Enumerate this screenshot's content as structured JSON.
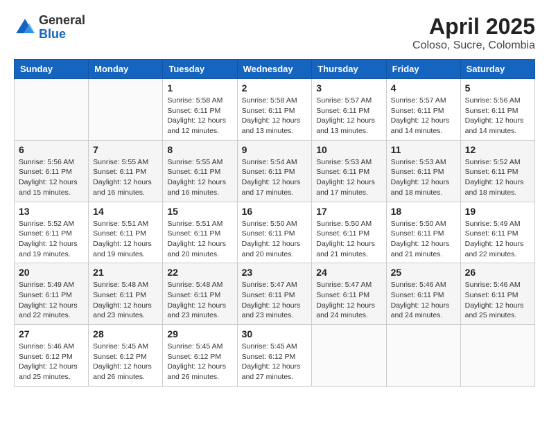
{
  "header": {
    "logo_general": "General",
    "logo_blue": "Blue",
    "title": "April 2025",
    "subtitle": "Coloso, Sucre, Colombia"
  },
  "weekdays": [
    "Sunday",
    "Monday",
    "Tuesday",
    "Wednesday",
    "Thursday",
    "Friday",
    "Saturday"
  ],
  "weeks": [
    [
      {
        "day": "",
        "sunrise": "",
        "sunset": "",
        "daylight": ""
      },
      {
        "day": "",
        "sunrise": "",
        "sunset": "",
        "daylight": ""
      },
      {
        "day": "1",
        "sunrise": "Sunrise: 5:58 AM",
        "sunset": "Sunset: 6:11 PM",
        "daylight": "Daylight: 12 hours and 12 minutes."
      },
      {
        "day": "2",
        "sunrise": "Sunrise: 5:58 AM",
        "sunset": "Sunset: 6:11 PM",
        "daylight": "Daylight: 12 hours and 13 minutes."
      },
      {
        "day": "3",
        "sunrise": "Sunrise: 5:57 AM",
        "sunset": "Sunset: 6:11 PM",
        "daylight": "Daylight: 12 hours and 13 minutes."
      },
      {
        "day": "4",
        "sunrise": "Sunrise: 5:57 AM",
        "sunset": "Sunset: 6:11 PM",
        "daylight": "Daylight: 12 hours and 14 minutes."
      },
      {
        "day": "5",
        "sunrise": "Sunrise: 5:56 AM",
        "sunset": "Sunset: 6:11 PM",
        "daylight": "Daylight: 12 hours and 14 minutes."
      }
    ],
    [
      {
        "day": "6",
        "sunrise": "Sunrise: 5:56 AM",
        "sunset": "Sunset: 6:11 PM",
        "daylight": "Daylight: 12 hours and 15 minutes."
      },
      {
        "day": "7",
        "sunrise": "Sunrise: 5:55 AM",
        "sunset": "Sunset: 6:11 PM",
        "daylight": "Daylight: 12 hours and 16 minutes."
      },
      {
        "day": "8",
        "sunrise": "Sunrise: 5:55 AM",
        "sunset": "Sunset: 6:11 PM",
        "daylight": "Daylight: 12 hours and 16 minutes."
      },
      {
        "day": "9",
        "sunrise": "Sunrise: 5:54 AM",
        "sunset": "Sunset: 6:11 PM",
        "daylight": "Daylight: 12 hours and 17 minutes."
      },
      {
        "day": "10",
        "sunrise": "Sunrise: 5:53 AM",
        "sunset": "Sunset: 6:11 PM",
        "daylight": "Daylight: 12 hours and 17 minutes."
      },
      {
        "day": "11",
        "sunrise": "Sunrise: 5:53 AM",
        "sunset": "Sunset: 6:11 PM",
        "daylight": "Daylight: 12 hours and 18 minutes."
      },
      {
        "day": "12",
        "sunrise": "Sunrise: 5:52 AM",
        "sunset": "Sunset: 6:11 PM",
        "daylight": "Daylight: 12 hours and 18 minutes."
      }
    ],
    [
      {
        "day": "13",
        "sunrise": "Sunrise: 5:52 AM",
        "sunset": "Sunset: 6:11 PM",
        "daylight": "Daylight: 12 hours and 19 minutes."
      },
      {
        "day": "14",
        "sunrise": "Sunrise: 5:51 AM",
        "sunset": "Sunset: 6:11 PM",
        "daylight": "Daylight: 12 hours and 19 minutes."
      },
      {
        "day": "15",
        "sunrise": "Sunrise: 5:51 AM",
        "sunset": "Sunset: 6:11 PM",
        "daylight": "Daylight: 12 hours and 20 minutes."
      },
      {
        "day": "16",
        "sunrise": "Sunrise: 5:50 AM",
        "sunset": "Sunset: 6:11 PM",
        "daylight": "Daylight: 12 hours and 20 minutes."
      },
      {
        "day": "17",
        "sunrise": "Sunrise: 5:50 AM",
        "sunset": "Sunset: 6:11 PM",
        "daylight": "Daylight: 12 hours and 21 minutes."
      },
      {
        "day": "18",
        "sunrise": "Sunrise: 5:50 AM",
        "sunset": "Sunset: 6:11 PM",
        "daylight": "Daylight: 12 hours and 21 minutes."
      },
      {
        "day": "19",
        "sunrise": "Sunrise: 5:49 AM",
        "sunset": "Sunset: 6:11 PM",
        "daylight": "Daylight: 12 hours and 22 minutes."
      }
    ],
    [
      {
        "day": "20",
        "sunrise": "Sunrise: 5:49 AM",
        "sunset": "Sunset: 6:11 PM",
        "daylight": "Daylight: 12 hours and 22 minutes."
      },
      {
        "day": "21",
        "sunrise": "Sunrise: 5:48 AM",
        "sunset": "Sunset: 6:11 PM",
        "daylight": "Daylight: 12 hours and 23 minutes."
      },
      {
        "day": "22",
        "sunrise": "Sunrise: 5:48 AM",
        "sunset": "Sunset: 6:11 PM",
        "daylight": "Daylight: 12 hours and 23 minutes."
      },
      {
        "day": "23",
        "sunrise": "Sunrise: 5:47 AM",
        "sunset": "Sunset: 6:11 PM",
        "daylight": "Daylight: 12 hours and 23 minutes."
      },
      {
        "day": "24",
        "sunrise": "Sunrise: 5:47 AM",
        "sunset": "Sunset: 6:11 PM",
        "daylight": "Daylight: 12 hours and 24 minutes."
      },
      {
        "day": "25",
        "sunrise": "Sunrise: 5:46 AM",
        "sunset": "Sunset: 6:11 PM",
        "daylight": "Daylight: 12 hours and 24 minutes."
      },
      {
        "day": "26",
        "sunrise": "Sunrise: 5:46 AM",
        "sunset": "Sunset: 6:11 PM",
        "daylight": "Daylight: 12 hours and 25 minutes."
      }
    ],
    [
      {
        "day": "27",
        "sunrise": "Sunrise: 5:46 AM",
        "sunset": "Sunset: 6:12 PM",
        "daylight": "Daylight: 12 hours and 25 minutes."
      },
      {
        "day": "28",
        "sunrise": "Sunrise: 5:45 AM",
        "sunset": "Sunset: 6:12 PM",
        "daylight": "Daylight: 12 hours and 26 minutes."
      },
      {
        "day": "29",
        "sunrise": "Sunrise: 5:45 AM",
        "sunset": "Sunset: 6:12 PM",
        "daylight": "Daylight: 12 hours and 26 minutes."
      },
      {
        "day": "30",
        "sunrise": "Sunrise: 5:45 AM",
        "sunset": "Sunset: 6:12 PM",
        "daylight": "Daylight: 12 hours and 27 minutes."
      },
      {
        "day": "",
        "sunrise": "",
        "sunset": "",
        "daylight": ""
      },
      {
        "day": "",
        "sunrise": "",
        "sunset": "",
        "daylight": ""
      },
      {
        "day": "",
        "sunrise": "",
        "sunset": "",
        "daylight": ""
      }
    ]
  ]
}
